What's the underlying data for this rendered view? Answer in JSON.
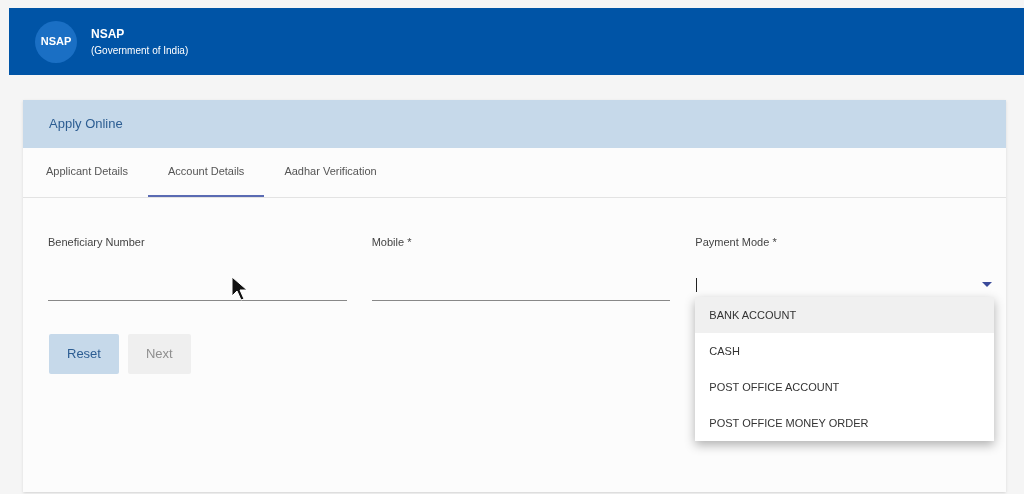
{
  "header": {
    "logo": "NSAP",
    "title": "NSAP",
    "subtitle": "(Government of India)"
  },
  "card": {
    "title": "Apply Online",
    "tabs": [
      {
        "label": "Applicant Details",
        "selected": false
      },
      {
        "label": "Account Details",
        "selected": true
      },
      {
        "label": "Aadhar Verification",
        "selected": false
      }
    ],
    "fields": [
      {
        "label": "Beneficiary Number",
        "kind": "text",
        "focused": false
      },
      {
        "label": "Mobile *",
        "kind": "text",
        "focused": false
      },
      {
        "label": "Payment Mode *",
        "kind": "select",
        "focused": true,
        "expanded": true,
        "options": [
          {
            "label": "BANK ACCOUNT",
            "highlighted": true
          },
          {
            "label": "CASH",
            "highlighted": false
          },
          {
            "label": "POST OFFICE ACCOUNT",
            "highlighted": false
          },
          {
            "label": "POST OFFICE MONEY ORDER",
            "highlighted": false
          }
        ]
      }
    ],
    "buttons": [
      {
        "label": "Reset",
        "disabled": false
      },
      {
        "label": "Next",
        "disabled": true
      }
    ]
  }
}
